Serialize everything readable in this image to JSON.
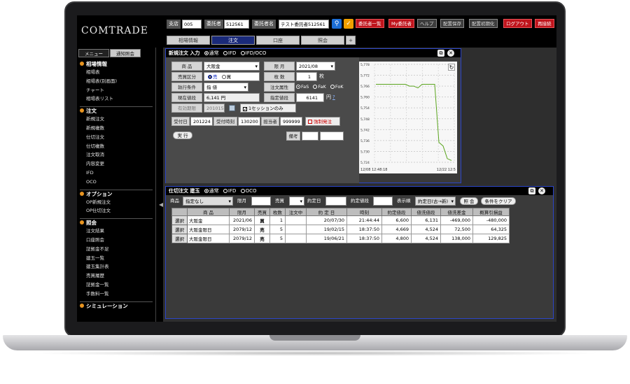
{
  "app": {
    "logo": "COMTRADE"
  },
  "header": {
    "branch_label": "支店",
    "branch_value": "005",
    "client_label": "委託者",
    "client_value": "512561",
    "client_name_label": "委託者名",
    "client_name_value": "テスト委託者512561",
    "btn_client_list": "委託者一覧",
    "btn_my_client": "My委託者",
    "btn_help": "ヘルプ",
    "btn_save_layout": "配置保存",
    "btn_init_layout": "配置初期化",
    "btn_logout": "ログアウト",
    "btn_relogin": "再接続"
  },
  "tabs": [
    "相場情報",
    "注文",
    "口座",
    "照会",
    "+"
  ],
  "sidebar": {
    "tab_menu": "メニュー",
    "tab_notify": "通知照会",
    "sections": [
      {
        "title": "相場情報",
        "items": [
          "相場表",
          "相場表(別画面)",
          "チャート",
          "相場表リスト"
        ]
      },
      {
        "title": "注文",
        "items": [
          "新規注文",
          "新規複数",
          "仕切注文",
          "仕切複数",
          "注文取消",
          "内容変更",
          "IFD",
          "OCO"
        ]
      },
      {
        "title": "オプション",
        "items": [
          "OP新規注文",
          "OP仕切注文"
        ]
      },
      {
        "title": "照会",
        "items": [
          "注文結果",
          "口座照会",
          "証拠金不足",
          "建玉一覧",
          "建玉集計表",
          "売買履歴",
          "証拠金一覧",
          "手数料一覧"
        ]
      },
      {
        "title": "シミュレーション",
        "items": []
      }
    ]
  },
  "new_order": {
    "title": "新規注文 入力",
    "modes": [
      "通常",
      "IFD",
      "IFD/OCO"
    ],
    "product_label": "商 品",
    "product_value": "大阪金",
    "month_label": "限 月",
    "month_value": "2021/08",
    "side_label": "売買区分",
    "side_sell": "売",
    "side_buy": "買",
    "qty_label": "枚 数",
    "qty_value": "1",
    "qty_unit": "枚",
    "cond_label": "執行条件",
    "cond_value": "指 値",
    "attr_label": "注文属性",
    "attr_opts": [
      "FaS",
      "FaK",
      "FoK"
    ],
    "cur_label": "現在値段",
    "cur_value": "6,141 円",
    "price_label": "指定値段",
    "price_value": "6141",
    "price_unit": "円",
    "price_help": "?",
    "expiry_label": "有効期限",
    "expiry_value": "201015",
    "session_label": "1セッションのみ",
    "recv_date_label": "受付日",
    "recv_date_value": "201224",
    "recv_time_label": "受付時刻",
    "recv_time_value": "130200",
    "staff_label": "担当者",
    "staff_value": "999999",
    "force_label": "強制発注",
    "exec_label": "実 行",
    "memo_label": "備考"
  },
  "chart_data": {
    "type": "line",
    "y_ticks": [
      "5,778",
      "5,772",
      "5,766",
      "5,760",
      "5,754",
      "5,748",
      "5,742",
      "5,736",
      "5,730",
      "5,724"
    ],
    "x_labels": [
      "12/08 12:48:18",
      "12/22 12:5"
    ],
    "ylim": [
      5724,
      5778
    ],
    "values": [
      5767,
      5767,
      5767,
      5767,
      5767,
      5767,
      5767,
      5767,
      5766,
      5766,
      5765,
      5767,
      5767,
      5767,
      5767,
      5735,
      5733,
      5726,
      5725
    ],
    "line_color": "#5aa51e"
  },
  "close_order": {
    "title": "仕切注文 建玉",
    "modes": [
      "通常",
      "IFD",
      "OCO"
    ],
    "product_label": "商品",
    "product_value": "指定なし",
    "month_label": "限月",
    "side_label": "売買",
    "date_label": "約定日",
    "price_label": "約定値段",
    "sort_label": "表示順",
    "sort_value": "約定日(古→新)",
    "btn_query": "照 会",
    "btn_clear": "条件をクリア",
    "columns": [
      "",
      "商 品",
      "限月",
      "売買",
      "枚数",
      "注文中",
      "約 定 日",
      "時刻",
      "約定値段",
      "値洗値段",
      "値洗差金",
      "概算引損益"
    ],
    "rows": [
      {
        "sel": "選択",
        "product": "大阪金",
        "month": "2021/06",
        "side": "買",
        "side_type": "buy",
        "qty": "1",
        "pending": "",
        "date": "20/07/30",
        "time": "21:44:44",
        "price": "6,600",
        "mark": "6,131",
        "diff": "-469,000",
        "pl": "-480,000",
        "neg": true
      },
      {
        "sel": "選択",
        "product": "大阪金限日",
        "month": "2079/12",
        "side": "売",
        "side_type": "sell",
        "qty": "5",
        "pending": "",
        "date": "19/02/15",
        "time": "18:37:50",
        "price": "4,669",
        "mark": "4,524",
        "diff": "72,500",
        "pl": "64,325",
        "neg": false
      },
      {
        "sel": "選択",
        "product": "大阪金限日",
        "month": "2079/12",
        "side": "売",
        "side_type": "sell",
        "qty": "5",
        "pending": "",
        "date": "19/06/21",
        "time": "18:37:50",
        "price": "4,800",
        "mark": "4,524",
        "diff": "138,000",
        "pl": "129,825",
        "neg": false
      }
    ]
  }
}
